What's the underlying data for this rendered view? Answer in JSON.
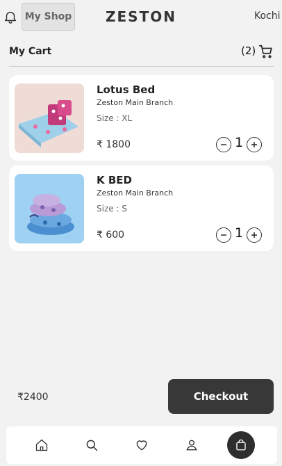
{
  "header": {
    "shop_label": "My Shop",
    "brand": "ZESTON",
    "location": "Kochi",
    "bell_icon": "bell-icon"
  },
  "cart": {
    "title": "My Cart",
    "count": "(2)",
    "icon": "shopping-cart-icon"
  },
  "items": [
    {
      "name": "Lotus Bed",
      "branch": "Zeston Main Branch",
      "size": "Size : XL",
      "price": "₹ 1800",
      "qty": "1"
    },
    {
      "name": "K BED",
      "branch": "Zeston Main Branch",
      "size": "Size : S",
      "price": "₹ 600",
      "qty": "1"
    }
  ],
  "footer": {
    "total": "₹2400",
    "checkout_label": "Checkout"
  },
  "nav": {
    "items": [
      "home-icon",
      "search-icon",
      "heart-icon",
      "user-icon",
      "shopping-bag-icon"
    ],
    "active": "shopping-bag-icon"
  },
  "colors": {
    "background": "#f2f2f2",
    "card": "#ffffff",
    "checkout": "#383838",
    "nav_active": "#2e2e2e"
  }
}
